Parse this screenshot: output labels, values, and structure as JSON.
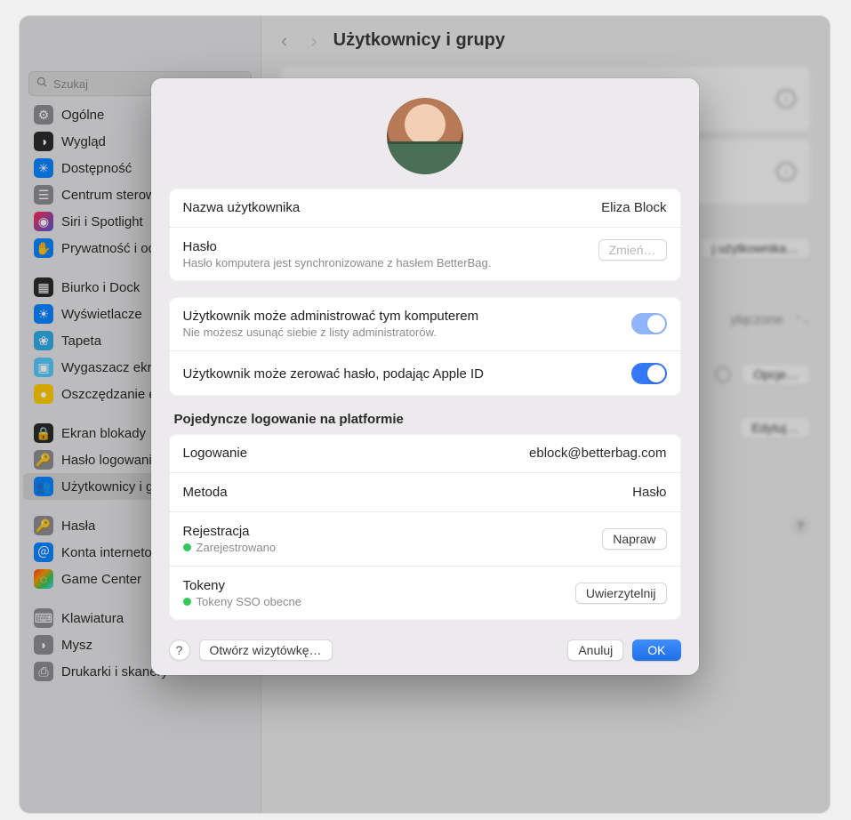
{
  "window": {
    "title": "Użytkownicy i grupy"
  },
  "search": {
    "placeholder": "Szukaj"
  },
  "sidebar": {
    "groups": [
      [
        {
          "label": "Ogólne",
          "color": "#8e8e93",
          "glyph": "⚙"
        },
        {
          "label": "Wygląd",
          "color": "#2b2b2b",
          "glyph": "◑"
        },
        {
          "label": "Dostępność",
          "color": "#0a84ff",
          "glyph": "✳"
        },
        {
          "label": "Centrum sterowania",
          "color": "#8e8e93",
          "glyph": "☰"
        },
        {
          "label": "Siri i Spotlight",
          "color": "linear-gradient(135deg,#ff2d55,#5856d6)",
          "glyph": "◉"
        },
        {
          "label": "Prywatność i ochrona",
          "color": "#0a84ff",
          "glyph": "✋"
        }
      ],
      [
        {
          "label": "Biurko i Dock",
          "color": "#2b2b2b",
          "glyph": "▦"
        },
        {
          "label": "Wyświetlacze",
          "color": "#0a84ff",
          "glyph": "☀"
        },
        {
          "label": "Tapeta",
          "color": "#32ade6",
          "glyph": "❀"
        },
        {
          "label": "Wygaszacz ekranu",
          "color": "#5ac8fa",
          "glyph": "▣"
        },
        {
          "label": "Oszczędzanie energii",
          "color": "#ffcc00",
          "glyph": "●"
        }
      ],
      [
        {
          "label": "Ekran blokady",
          "color": "#2b2b2b",
          "glyph": "🔒"
        },
        {
          "label": "Hasło logowania",
          "color": "#8e8e93",
          "glyph": "🔑"
        },
        {
          "label": "Użytkownicy i grupy",
          "color": "#0a84ff",
          "glyph": "👥",
          "selected": true
        }
      ],
      [
        {
          "label": "Hasła",
          "color": "#8e8e93",
          "glyph": "🔑"
        },
        {
          "label": "Konta internetowe",
          "color": "#0a84ff",
          "glyph": "＠"
        },
        {
          "label": "Game Center",
          "color": "linear-gradient(135deg,#ff3b30,#ff9500,#34c759,#5ac8fa)",
          "glyph": "◌"
        }
      ],
      [
        {
          "label": "Klawiatura",
          "color": "#8e8e93",
          "glyph": "⌨"
        },
        {
          "label": "Mysz",
          "color": "#8e8e93",
          "glyph": "◗"
        },
        {
          "label": "Drukarki i skanery",
          "color": "#8e8e93",
          "glyph": "⎙"
        }
      ]
    ]
  },
  "bg": {
    "add_user": "j użytkownika…",
    "auto_login": "yłączone",
    "options": "Opcje…",
    "edit": "Edytuj…"
  },
  "sheet": {
    "username_label": "Nazwa użytkownika",
    "username_value": "Eliza Block",
    "password_label": "Hasło",
    "password_sub": "Hasło komputera jest synchronizowane z hasłem BetterBag.",
    "change_btn": "Zmień…",
    "admin_label": "Użytkownik może administrować tym komputerem",
    "admin_sub": "Nie możesz usunąć siebie z listy administratorów.",
    "reset_label": "Użytkownik może zerować hasło, podając Apple ID",
    "sso_heading": "Pojedyncze logowanie na platformie",
    "login_label": "Logowanie",
    "login_value": "eblock@betterbag.com",
    "method_label": "Metoda",
    "method_value": "Hasło",
    "reg_label": "Rejestracja",
    "reg_status": "Zarejestrowano",
    "reg_btn": "Napraw",
    "tokens_label": "Tokeny",
    "tokens_status": "Tokeny SSO obecne",
    "tokens_btn": "Uwierzytelnij",
    "open_card": "Otwórz wizytówkę…",
    "cancel": "Anuluj",
    "ok": "OK"
  }
}
